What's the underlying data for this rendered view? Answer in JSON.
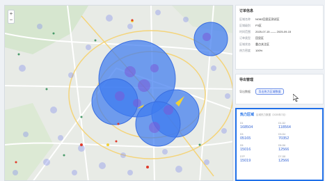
{
  "map": {
    "zoom_in": "+",
    "zoom_out": "−"
  },
  "info_card": {
    "title": "订单信息",
    "rows": [
      {
        "key": "区域名称",
        "value": "NO82回显区测试区"
      },
      {
        "key": "区域级别",
        "value": "P3区"
      },
      {
        "key": "时间范围",
        "value": "2025-07-15 —— 2025-09-15"
      },
      {
        "key": "订单类型",
        "value": "回显区"
      },
      {
        "key": "区域状态",
        "value": "重点关注区"
      },
      {
        "key": "热力密度",
        "value": "100%"
      }
    ]
  },
  "export_card": {
    "title": "导出管理",
    "label": "导出数据",
    "button": "导出热力区域数据"
  },
  "stats_card": {
    "title": "热力区域",
    "subtitle": "区域热力数据（2025年7月）",
    "items": [
      {
        "label": "D1",
        "value": "168504"
      },
      {
        "label": "D1-D2",
        "value": "118564"
      },
      {
        "label": "D3",
        "value": "05165"
      },
      {
        "label": "D3-D4",
        "value": "70352"
      },
      {
        "label": "D5",
        "value": "15016"
      },
      {
        "label": "D5-D6",
        "value": "12566"
      },
      {
        "label": "D7P",
        "value": "15019"
      },
      {
        "label": "D7-D8",
        "value": "12566"
      }
    ]
  },
  "colors": {
    "accent": "#1f6fe8",
    "circle_fill": "#3f7bf0",
    "heat_hot": "#e03a2a",
    "heat_warm": "#f0d038"
  }
}
